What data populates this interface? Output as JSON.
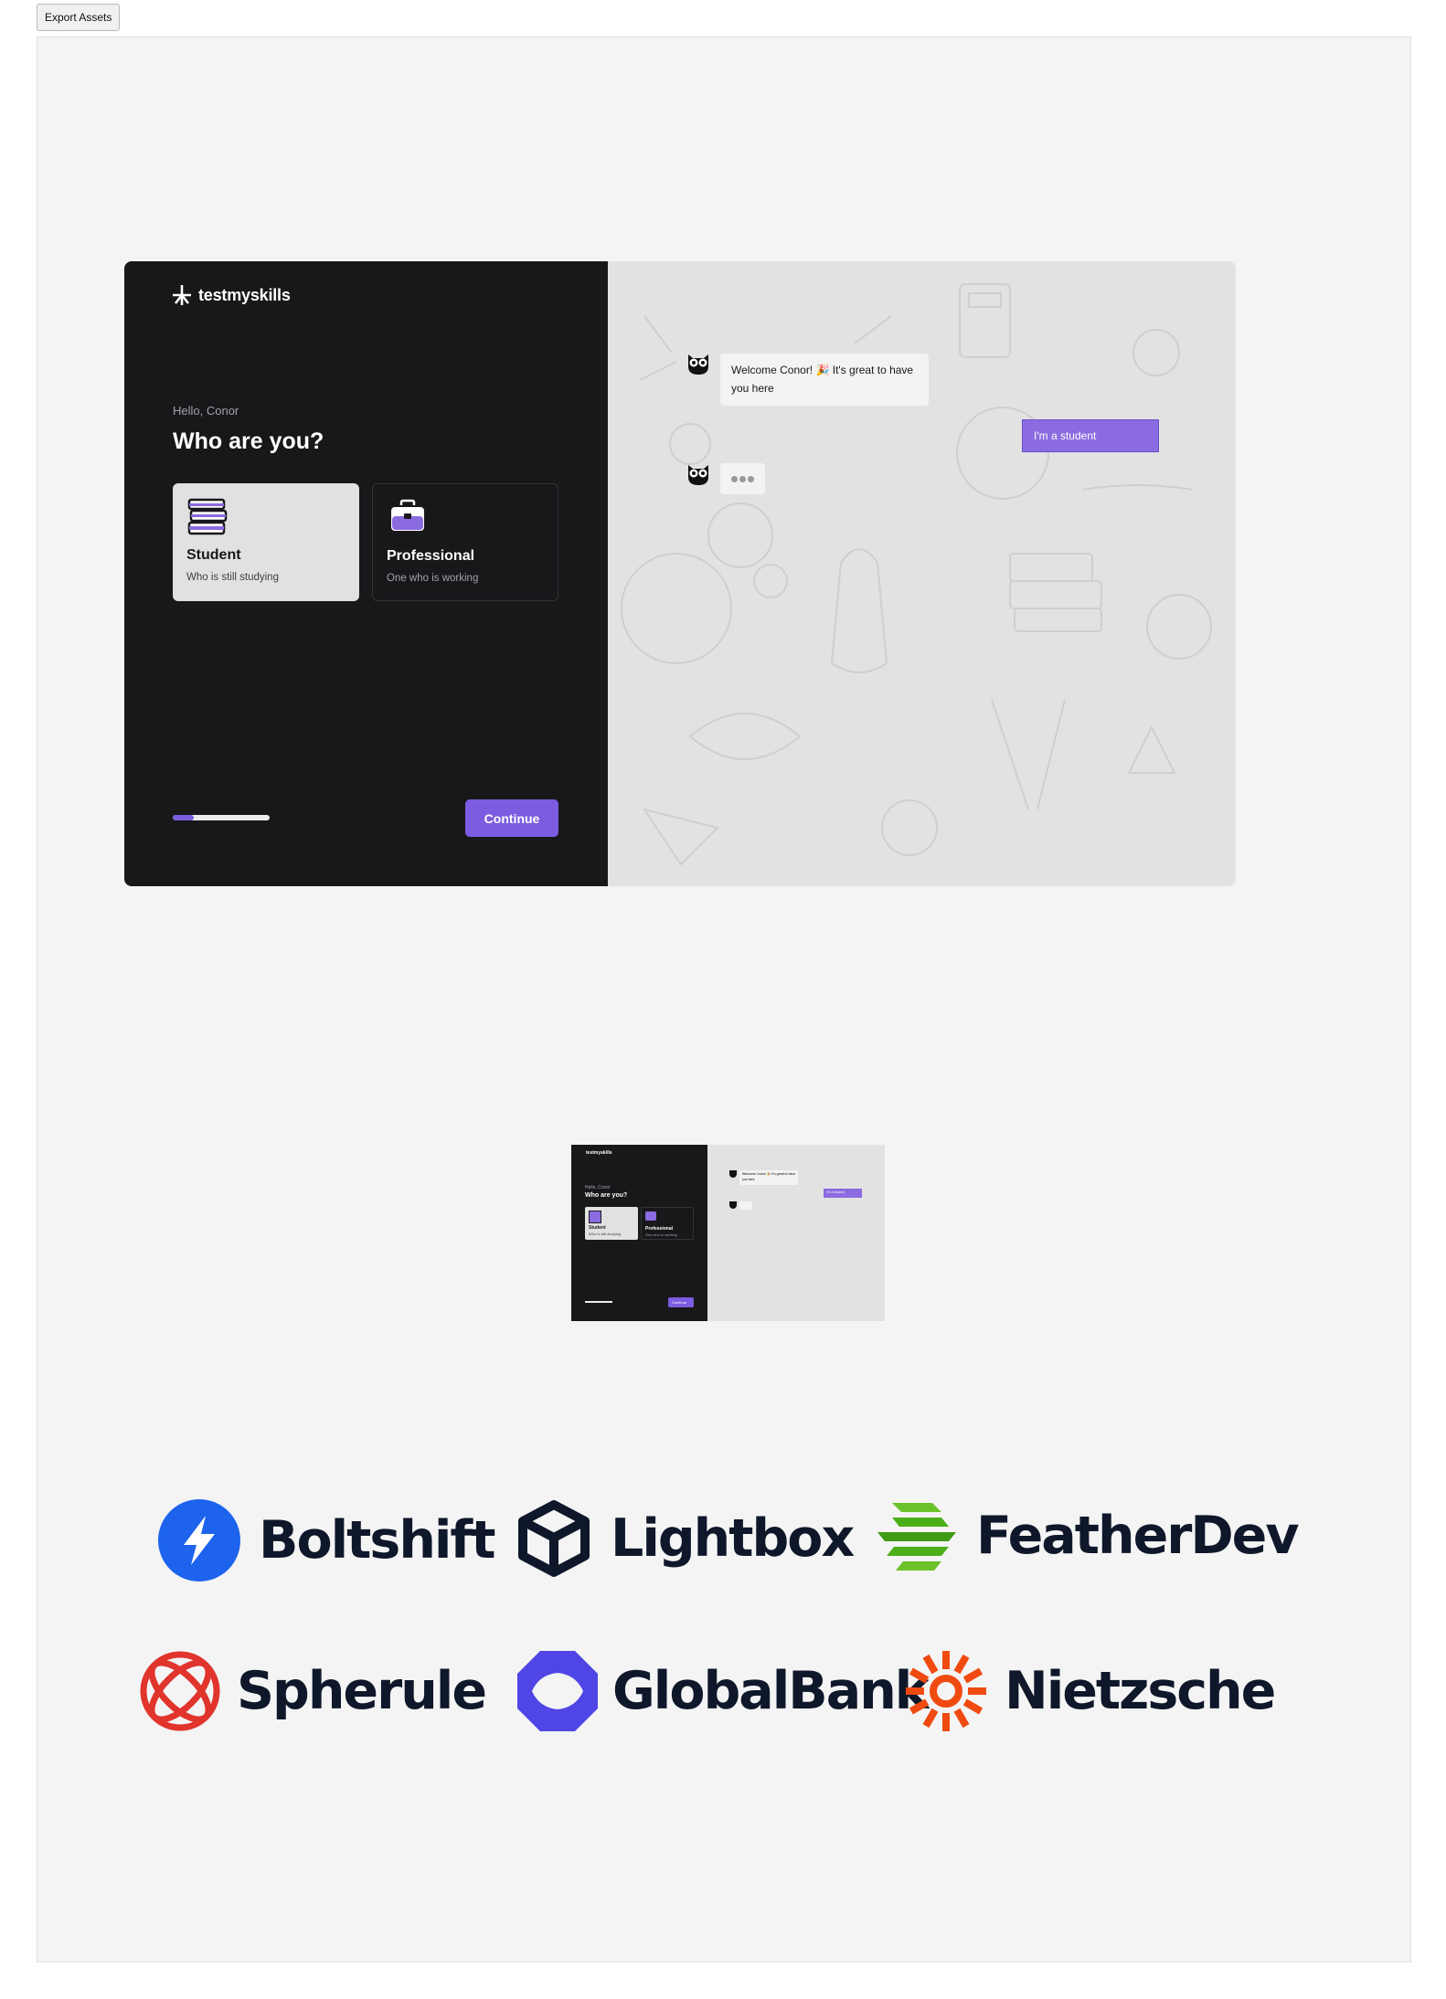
{
  "toolbar": {
    "export_label": "Export Assets"
  },
  "app": {
    "logo_text": "testmyskills",
    "greeting": "Hello, Conor",
    "heading": "Who are you?",
    "options": [
      {
        "title": "Student",
        "subtitle": "Who is still studying",
        "selected": true,
        "icon": "books-icon"
      },
      {
        "title": "Professional",
        "subtitle": "One who is working",
        "selected": false,
        "icon": "briefcase-icon"
      }
    ],
    "progress": 0.22,
    "continue_label": "Continue",
    "chat": {
      "welcome_line1": "Welcome Conor! 🎉 It's great to have",
      "welcome_line2": "you here",
      "reply": "I'm a student"
    }
  },
  "thumbnail": {
    "logo_text": "testmyskills",
    "greeting": "Hello, Conor",
    "heading": "Who are you?",
    "student": "Student",
    "student_sub": "Who is still studying",
    "professional": "Professional",
    "professional_sub": "One who is working",
    "continue_label": "Continue",
    "welcome_line1": "Welcome Conor! 🎉 It's great to have",
    "welcome_line2": "you here",
    "reply": "I'm a student"
  },
  "brands": [
    {
      "name": "Boltshift",
      "icon": "bolt-icon",
      "color": "#1d63ed"
    },
    {
      "name": "Lightbox",
      "icon": "cube-icon",
      "color": "#0f172a"
    },
    {
      "name": "FeatherDev",
      "icon": "feather-stripes-icon",
      "color": "#4caf1a"
    },
    {
      "name": "Spherule",
      "icon": "sphere-icon",
      "color": "#e0342c"
    },
    {
      "name": "GlobalBank",
      "icon": "octagon-icon",
      "color": "#4f46e5"
    },
    {
      "name": "Nietzsche",
      "icon": "sunburst-icon",
      "color": "#f04a10"
    }
  ]
}
